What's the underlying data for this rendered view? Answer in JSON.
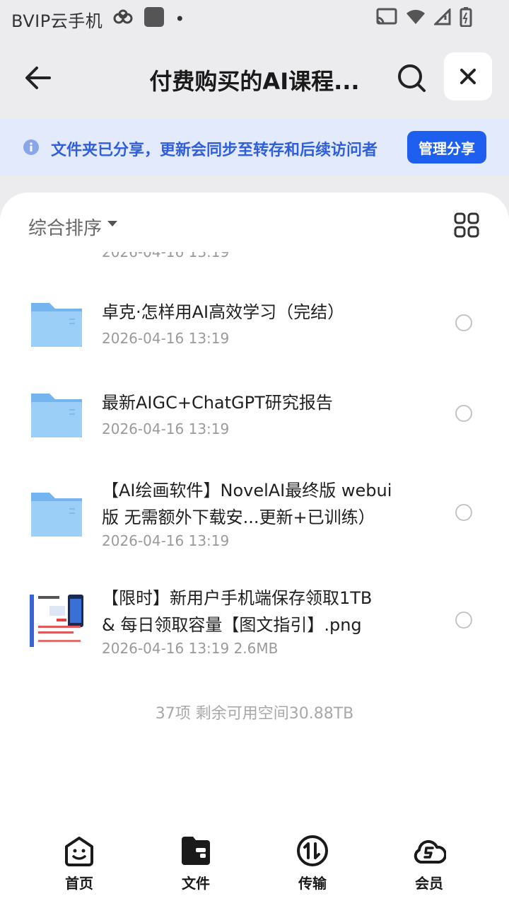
{
  "status_bar": {
    "title": "BVIP云手机",
    "dot": "•"
  },
  "header": {
    "title": "付费购买的AI课程...",
    "close_symbol": "✕"
  },
  "notice": {
    "text": "文件夹已分享，更新会同步至转存和后续访问者",
    "button": "管理分享"
  },
  "sort": {
    "label": "综合排序"
  },
  "cut_off_date": "2026-04-16 13:19",
  "files": [
    {
      "type": "folder",
      "name_lines": [
        "卓克·怎样用AI高效学习（完结）"
      ],
      "meta": "2026-04-16 13:19"
    },
    {
      "type": "folder",
      "name_lines": [
        "最新AIGC+ChatGPT研究报告"
      ],
      "meta": "2026-04-16 13:19"
    },
    {
      "type": "folder",
      "name_lines": [
        "【AI绘画软件】NovelAI最终版 webui",
        "版 无需额外下载安...更新+已训练）"
      ],
      "meta": "2026-04-16 13:19"
    },
    {
      "type": "image",
      "name_lines": [
        "【限时】新用户手机端保存领取1TB",
        "& 每日领取容量【图文指引】.png"
      ],
      "meta": "2026-04-16 13:19  2.6MB"
    }
  ],
  "footer_info": "37项 剩余可用空间30.88TB",
  "bottom_nav": [
    {
      "label": "首页",
      "icon": "home-face-icon"
    },
    {
      "label": "文件",
      "icon": "folder-icon"
    },
    {
      "label": "传输",
      "icon": "transfer-icon"
    },
    {
      "label": "会员",
      "icon": "vip-cloud-icon"
    }
  ],
  "colors": {
    "accent": "#1f5ff0",
    "banner_bg": "#e3eafb",
    "banner_text": "#2f5fdc",
    "folder": "#8fc6f7"
  }
}
